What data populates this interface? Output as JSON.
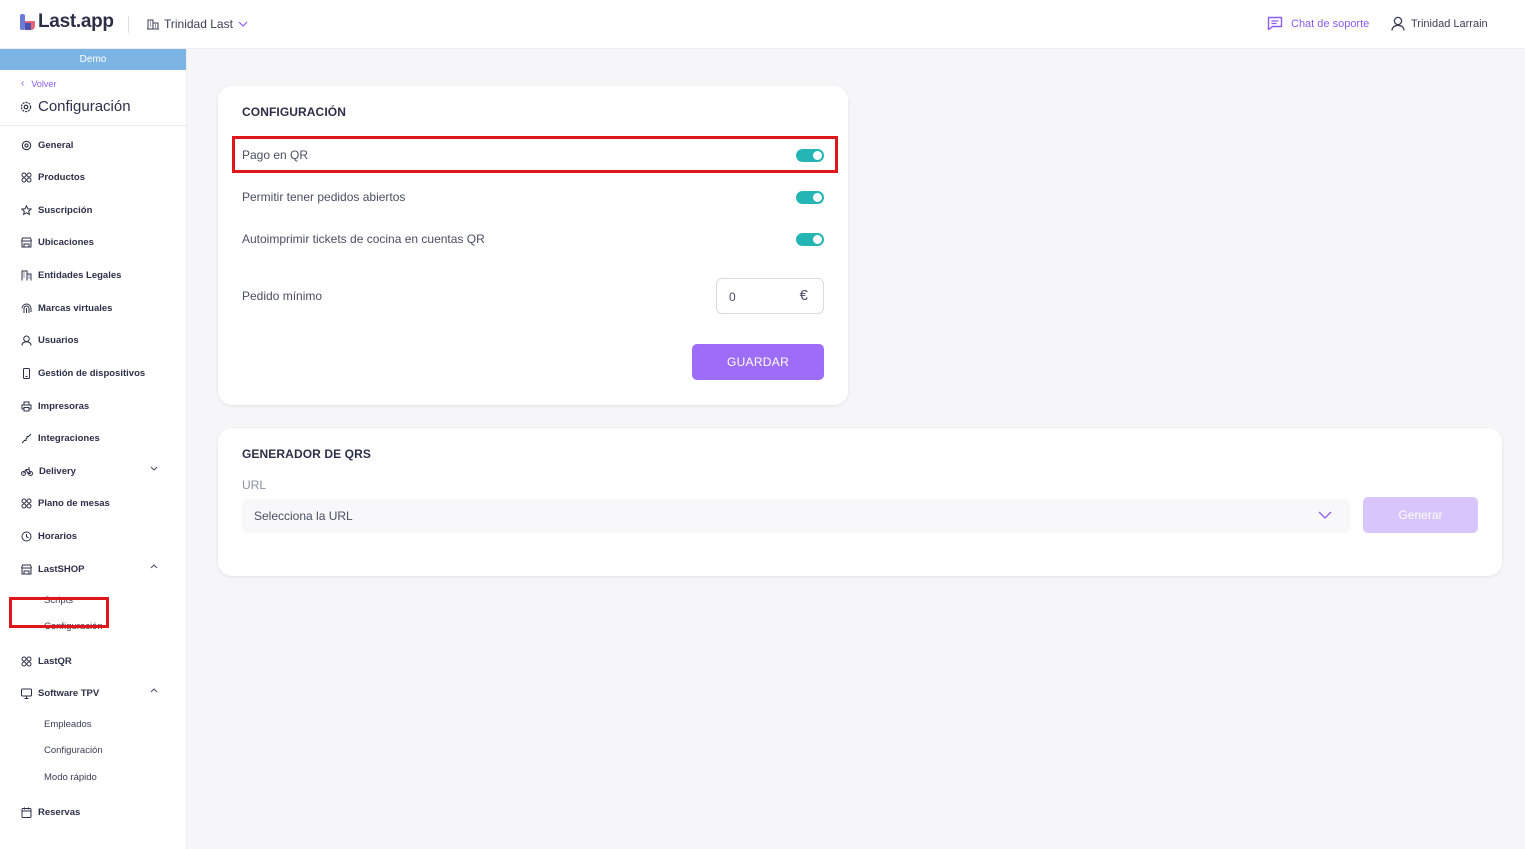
{
  "header": {
    "logo_text": "Last.app",
    "organization": "Trinidad Last",
    "support_label": "Chat de soporte",
    "user_name": "Trinidad Larrain"
  },
  "sidebar": {
    "demo_banner": "Demo",
    "back_label": "Volver",
    "title": "Configuración",
    "items": [
      {
        "label": "General",
        "icon": "gear-icon"
      },
      {
        "label": "Productos",
        "icon": "grid-icon"
      },
      {
        "label": "Suscripción",
        "icon": "star-icon"
      },
      {
        "label": "Ubicaciones",
        "icon": "store-icon"
      },
      {
        "label": "Entidades Legales",
        "icon": "building-icon"
      },
      {
        "label": "Marcas virtuales",
        "icon": "brands-icon"
      },
      {
        "label": "Usuarios",
        "icon": "user-icon"
      },
      {
        "label": "Gestión de dispositivos",
        "icon": "device-icon"
      },
      {
        "label": "Impresoras",
        "icon": "printer-icon"
      },
      {
        "label": "Integraciones",
        "icon": "plug-icon"
      },
      {
        "label": "Delivery",
        "icon": "bike-icon"
      },
      {
        "label": "Plano de mesas",
        "icon": "tables-icon"
      },
      {
        "label": "Horarios",
        "icon": "clock-icon"
      },
      {
        "label": "LastSHOP",
        "icon": "shop-icon"
      },
      {
        "label": "LastQR",
        "icon": "qr-icon"
      },
      {
        "label": "Software TPV",
        "icon": "monitor-icon"
      },
      {
        "label": "Reservas",
        "icon": "calendar-icon"
      }
    ],
    "lastshop_sub": [
      "Scripts",
      "Configuración"
    ],
    "tpv_sub": [
      "Empleados",
      "Configuración",
      "Modo rápido"
    ]
  },
  "config_card": {
    "title": "CONFIGURACIÓN",
    "pago_qr_label": "Pago en QR",
    "pago_qr_enabled": true,
    "pedidos_abiertos_label": "Permitir tener pedidos abiertos",
    "pedidos_abiertos_enabled": true,
    "autoimprimir_label": "Autoimprimir tickets de cocina en cuentas QR",
    "autoimprimir_enabled": true,
    "pedido_minimo_label": "Pedido mínimo",
    "pedido_minimo_value": "0",
    "currency_symbol": "€",
    "save_label": "GUARDAR"
  },
  "qr_card": {
    "title": "GENERADOR DE QRS",
    "url_label": "URL",
    "url_placeholder": "Selecciona la URL",
    "generate_label": "Generar"
  },
  "colors": {
    "accent": "#9e6df8",
    "toggle_on": "#26b5b5",
    "highlight": "#e0161b",
    "demo_banner": "#7cb4e3"
  }
}
